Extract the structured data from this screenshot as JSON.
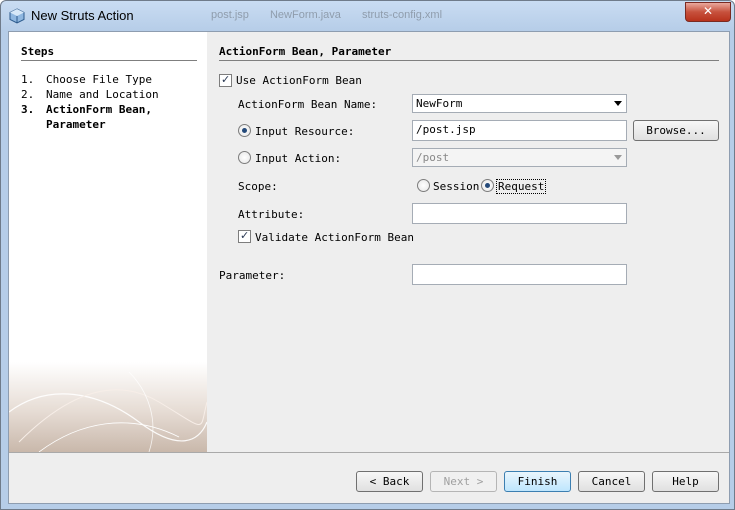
{
  "window": {
    "title": "New Struts Action",
    "background_tabs": [
      "post.jsp",
      "NewForm.java",
      "struts-config.xml"
    ],
    "close_glyph": "✕"
  },
  "steps": {
    "title": "Steps",
    "items": [
      {
        "num": "1.",
        "label": "Choose File Type",
        "current": false
      },
      {
        "num": "2.",
        "label": "Name and Location",
        "current": false
      },
      {
        "num": "3.",
        "label": "ActionForm Bean, Parameter",
        "current": true
      }
    ]
  },
  "section": {
    "title": "ActionForm Bean, Parameter",
    "use_actionform_bean": {
      "label": "Use ActionForm Bean",
      "checked": true
    },
    "bean_name": {
      "label": "ActionForm Bean Name:",
      "value": "NewForm"
    },
    "input_resource": {
      "label": "Input Resource:",
      "value": "/post.jsp",
      "selected": true
    },
    "browse_button": "Browse...",
    "input_action": {
      "label": "Input Action:",
      "value": "/post",
      "selected": false
    },
    "scope": {
      "label": "Scope:",
      "session_label": "Session",
      "request_label": "Request",
      "selected": "Request"
    },
    "attribute": {
      "label": "Attribute:",
      "value": ""
    },
    "validate": {
      "label": "Validate ActionForm Bean",
      "checked": true
    },
    "parameter": {
      "label": "Parameter:",
      "value": ""
    }
  },
  "buttons": {
    "back": "< Back",
    "next": "Next >",
    "finish": "Finish",
    "cancel": "Cancel",
    "help": "Help"
  },
  "colors": {
    "title_bar": "#c9dcf2",
    "close_button": "#c7513d",
    "dialog_bg": "#eeeeee",
    "radio_dot": "#254a7a"
  }
}
